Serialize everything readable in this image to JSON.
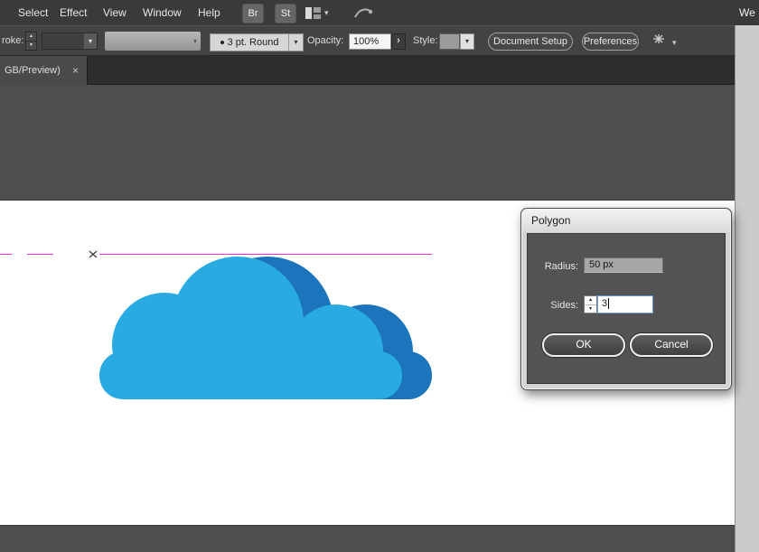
{
  "menubar": {
    "items": [
      "Select",
      "Effect",
      "View",
      "Window",
      "Help"
    ],
    "badges": [
      "Br",
      "St"
    ],
    "right_text": "We"
  },
  "controlbar": {
    "stroke_label": "roke:",
    "brush_value": "3 pt. Round",
    "opacity_label": "Opacity:",
    "opacity_value": "100%",
    "style_label": "Style:",
    "buttons": {
      "document_setup": "Document Setup",
      "preferences": "Preferences"
    }
  },
  "tabbar": {
    "tab_label": "GB/Preview)"
  },
  "dialog": {
    "title": "Polygon",
    "fields": [
      {
        "label": "Radius:",
        "value": "50 px"
      },
      {
        "label": "Sides:",
        "value": "3"
      }
    ],
    "buttons": {
      "ok": "OK",
      "cancel": "Cancel"
    }
  },
  "icons": {
    "dropdown": "▾",
    "spin_up": "▴",
    "spin_down": "▾",
    "arrow_right": "›",
    "close": "×"
  },
  "colors": {
    "cloud_front": "#29ABE2",
    "cloud_back": "#1C75BC",
    "guide": "#FF2BD6",
    "anchor_mark": "#3a3a3a"
  }
}
